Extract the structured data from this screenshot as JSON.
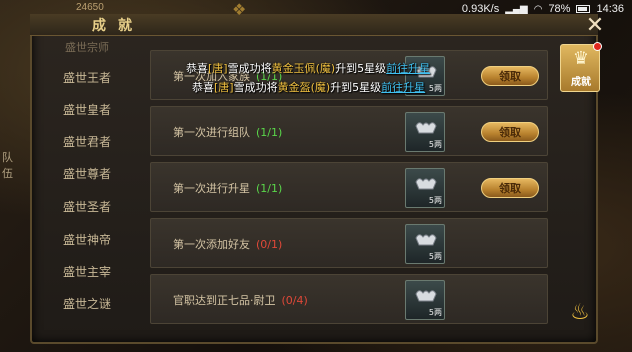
{
  "status": {
    "speed": "0.93K/s",
    "battery": "78%",
    "time": "14:36"
  },
  "hud": {
    "coins": "24650",
    "left_label": "队\n伍"
  },
  "panel": {
    "title": "成就",
    "close": "✕"
  },
  "sidebar": {
    "items": [
      {
        "label": "盛世宗师",
        "faded": true
      },
      {
        "label": "盛世王者"
      },
      {
        "label": "盛世皇者"
      },
      {
        "label": "盛世君者"
      },
      {
        "label": "盛世尊者"
      },
      {
        "label": "盛世圣者"
      },
      {
        "label": "盛世神帝"
      },
      {
        "label": "盛世主宰"
      },
      {
        "label": "盛世之谜"
      }
    ]
  },
  "achievements": [
    {
      "title": "第一次加入家族",
      "progress": "(1/1)",
      "done": true,
      "reward": "5两",
      "button": "领取"
    },
    {
      "title": "第一次进行组队",
      "progress": "(1/1)",
      "done": true,
      "reward": "5两",
      "button": "领取"
    },
    {
      "title": "第一次进行升星",
      "progress": "(1/1)",
      "done": true,
      "reward": "5两",
      "button": "领取"
    },
    {
      "title": "第一次添加好友",
      "progress": "(0/1)",
      "done": false,
      "reward": "5两",
      "button": ""
    },
    {
      "title": "官职达到正七品·尉卫",
      "progress": "(0/4)",
      "done": false,
      "reward": "5两",
      "button": ""
    }
  ],
  "notices": [
    {
      "prefix": "恭喜",
      "tang": "[唐]",
      "name": "雪成功将",
      "item": "黄金玉佩(魔)",
      "suffix": "升到5星级",
      "link": "前往升星"
    },
    {
      "prefix": "恭喜",
      "tang": "[唐]",
      "name": "雪成功将",
      "item": "黄金盔(魔)",
      "suffix": "升到5星级",
      "link": "前往升星"
    }
  ],
  "right_tab": {
    "label": "成就",
    "icon": "trophy-icon"
  },
  "colors": {
    "gold": "#e8d08a",
    "progress_done": "#5ad64a",
    "progress_none": "#e04838",
    "link": "#40c0f0"
  }
}
